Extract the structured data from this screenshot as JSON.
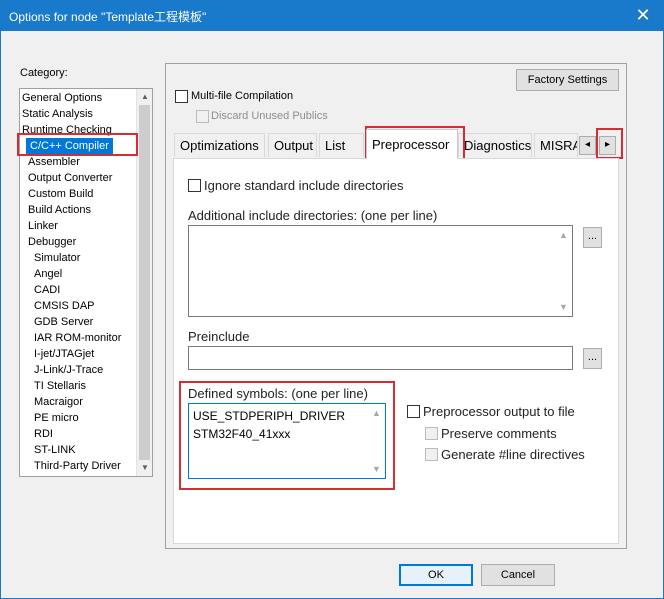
{
  "window": {
    "title": "Options for node \"Template工程模板\"",
    "close_glyph": "✕"
  },
  "category": {
    "label": "Category:",
    "items": [
      {
        "label": "General Options",
        "indent": 0
      },
      {
        "label": "Static Analysis",
        "indent": 0
      },
      {
        "label": "Runtime Checking",
        "indent": 0
      },
      {
        "label": "C/C++ Compiler",
        "indent": 1,
        "selected": true
      },
      {
        "label": "Assembler",
        "indent": 1
      },
      {
        "label": "Output Converter",
        "indent": 1
      },
      {
        "label": "Custom Build",
        "indent": 1
      },
      {
        "label": "Build Actions",
        "indent": 1
      },
      {
        "label": "Linker",
        "indent": 1
      },
      {
        "label": "Debugger",
        "indent": 1
      },
      {
        "label": "Simulator",
        "indent": 2
      },
      {
        "label": "Angel",
        "indent": 2
      },
      {
        "label": "CADI",
        "indent": 2
      },
      {
        "label": "CMSIS DAP",
        "indent": 2
      },
      {
        "label": "GDB Server",
        "indent": 2
      },
      {
        "label": "IAR ROM-monitor",
        "indent": 2
      },
      {
        "label": "I-jet/JTAGjet",
        "indent": 2
      },
      {
        "label": "J-Link/J-Trace",
        "indent": 2
      },
      {
        "label": "TI Stellaris",
        "indent": 2
      },
      {
        "label": "Macraigor",
        "indent": 2
      },
      {
        "label": "PE micro",
        "indent": 2
      },
      {
        "label": "RDI",
        "indent": 2
      },
      {
        "label": "ST-LINK",
        "indent": 2
      },
      {
        "label": "Third-Party Driver",
        "indent": 2
      }
    ]
  },
  "top": {
    "factory_settings": "Factory Settings",
    "multi_file": "Multi-file Compilation",
    "discard_unused": "Discard Unused Publics"
  },
  "tabs": [
    "Optimizations",
    "Output",
    "List",
    "Preprocessor",
    "Diagnostics",
    "MISRA"
  ],
  "active_tab": "Preprocessor",
  "tab_nav": {
    "left": "◂",
    "right": "▸"
  },
  "preprocessor": {
    "ignore_std": "Ignore standard include directories",
    "additional_label": "Additional include directories: (one per line)",
    "additional_value": "",
    "preinclude_label": "Preinclude",
    "preinclude_value": "",
    "defined_label": "Defined symbols: (one per line)",
    "defined_lines": [
      "USE_STDPERIPH_DRIVER",
      "STM32F40_41xxx"
    ],
    "pp_output": "Preprocessor output to file",
    "preserve_comments": "Preserve comments",
    "generate_line": "Generate #line directives",
    "browse": "..."
  },
  "buttons": {
    "ok": "OK",
    "cancel": "Cancel"
  },
  "highlight_color": "#d62d35"
}
